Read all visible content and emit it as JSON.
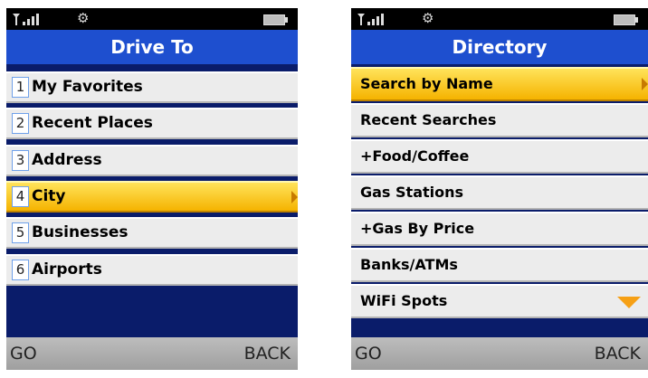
{
  "status": {
    "signal": "signal-icon",
    "settings": "gear-icon",
    "battery": "battery-icon"
  },
  "left": {
    "title": "Drive To",
    "items": [
      {
        "num": "1",
        "label": "My Favorites"
      },
      {
        "num": "2",
        "label": "Recent Places"
      },
      {
        "num": "3",
        "label": "Address"
      },
      {
        "num": "4",
        "label": "City",
        "selected": true
      },
      {
        "num": "5",
        "label": "Businesses"
      },
      {
        "num": "6",
        "label": "Airports"
      }
    ],
    "softkeys": {
      "left": "GO",
      "right": "BACK"
    }
  },
  "right": {
    "title": "Directory",
    "items": [
      {
        "label": "Search by Name",
        "selected": true
      },
      {
        "label": "Recent Searches"
      },
      {
        "label": "+Food/Coffee"
      },
      {
        "label": "Gas Stations"
      },
      {
        "label": "+Gas By Price"
      },
      {
        "label": "Banks/ATMs"
      },
      {
        "label": "WiFi Spots"
      }
    ],
    "softkeys": {
      "left": "GO",
      "right": "BACK"
    }
  },
  "colors": {
    "title_bar": "#1e4fcf",
    "background": "#0a1c6a",
    "highlight": "#f5b300"
  }
}
